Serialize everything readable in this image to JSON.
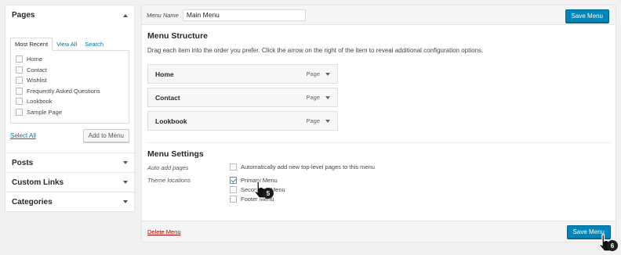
{
  "sidebar": {
    "pages": {
      "title": "Pages",
      "tabs": [
        "Most Recent",
        "View All",
        "Search"
      ],
      "items": [
        "Home",
        "Contact",
        "Wishlist",
        "Frequently Asked Questions",
        "Lookbook",
        "Sample Page"
      ],
      "select_all": "Select All",
      "add_button": "Add to Menu"
    },
    "collapsed_panels": [
      "Posts",
      "Custom Links",
      "Categories"
    ]
  },
  "main": {
    "menu_name_label": "Menu Name",
    "menu_name_value": "Main Menu",
    "save_label": "Save Menu",
    "structure_title": "Menu Structure",
    "instructions": "Drag each item into the order you prefer. Click the arrow on the right of the item to reveal additional configuration options.",
    "items": [
      {
        "title": "Home",
        "type": "Page"
      },
      {
        "title": "Contact",
        "type": "Page"
      },
      {
        "title": "Lookbook",
        "type": "Page"
      }
    ],
    "settings_title": "Menu Settings",
    "auto_add_label": "Auto add pages",
    "auto_add_text": "Automatically add new top-level pages to this menu",
    "theme_locations_label": "Theme locations",
    "locations": [
      {
        "label": "Primary Menu",
        "checked": true
      },
      {
        "label": "Secondary Menu",
        "checked": false
      },
      {
        "label": "Footer Menu",
        "checked": false
      }
    ],
    "delete_label": "Delete Menu"
  },
  "annotations": {
    "step_5": "5",
    "step_6": "6"
  },
  "colors": {
    "primary_button": "#0085ba",
    "link": "#0073aa",
    "delete": "#a00"
  }
}
